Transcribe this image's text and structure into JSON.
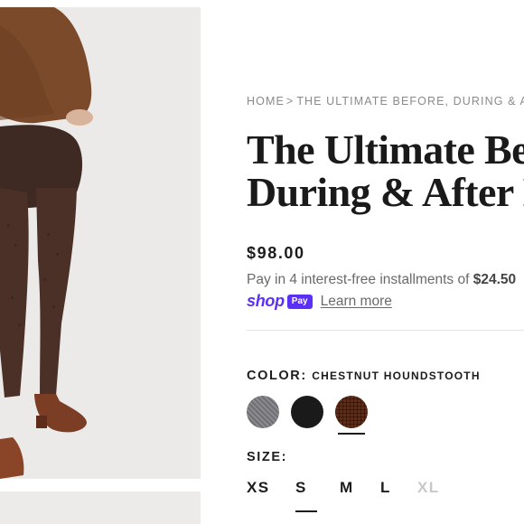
{
  "breadcrumb": {
    "home": "HOME",
    "separator": ">",
    "current": "THE ULTIMATE BEFORE, DURING & AFTER LEGGING"
  },
  "product": {
    "title_line1": "The Ultimate Before,",
    "title_line2": "During & After Legging",
    "price": "$98.00",
    "installments_prefix": "Pay in 4 interest-free installments of ",
    "installments_amount": "$24.50",
    "shop_word": "shop",
    "pay_badge": "Pay",
    "learn_more": "Learn more"
  },
  "color": {
    "label": "COLOR:",
    "selected": "CHESTNUT HOUNDSTOOTH",
    "swatches": [
      {
        "name": "Gray Houndstooth",
        "hex": "#7c7c80"
      },
      {
        "name": "Black",
        "hex": "#1a1a1a"
      },
      {
        "name": "Chestnut Houndstooth",
        "hex": "#5a2e1c",
        "selected": true
      }
    ]
  },
  "size": {
    "label": "SIZE:",
    "options": [
      "XS",
      "S",
      "M",
      "L",
      "XL"
    ],
    "selected": "S",
    "unavailable": [
      "XL"
    ]
  }
}
